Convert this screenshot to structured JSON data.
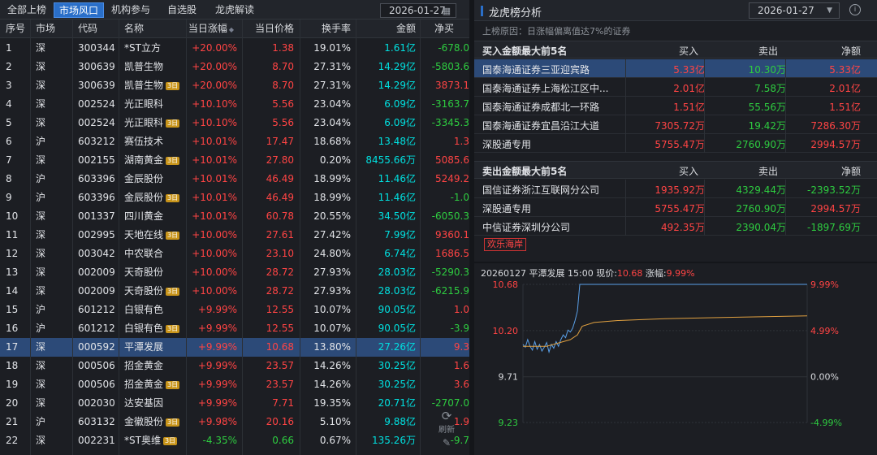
{
  "tabs": [
    "全部上榜",
    "市场风口",
    "机构参与",
    "自选股",
    "龙虎解读"
  ],
  "active_tab": 1,
  "date_left": "2026-01-27",
  "columns": [
    "序号",
    "市场",
    "代码",
    "名称",
    "当日涨幅",
    "当日价格",
    "换手率",
    "金额",
    "净买"
  ],
  "sort_icon": "◆",
  "rows": [
    {
      "no": "1",
      "mkt": "深",
      "code": "300344",
      "name": "*ST立方",
      "badge": "",
      "chg": "+20.00%",
      "price": "1.38",
      "turn": "19.01%",
      "amt": "1.61亿",
      "net": "-678.0",
      "netc": "green"
    },
    {
      "no": "2",
      "mkt": "深",
      "code": "300639",
      "name": "凯普生物",
      "badge": "",
      "chg": "+20.00%",
      "price": "8.70",
      "turn": "27.31%",
      "amt": "14.29亿",
      "net": "-5803.6",
      "netc": "green"
    },
    {
      "no": "3",
      "mkt": "深",
      "code": "300639",
      "name": "凯普生物",
      "badge": "3日",
      "chg": "+20.00%",
      "price": "8.70",
      "turn": "27.31%",
      "amt": "14.29亿",
      "net": "3873.1",
      "netc": "red"
    },
    {
      "no": "4",
      "mkt": "深",
      "code": "002524",
      "name": "光正眼科",
      "badge": "",
      "chg": "+10.10%",
      "price": "5.56",
      "turn": "23.04%",
      "amt": "6.09亿",
      "net": "-3163.7",
      "netc": "green"
    },
    {
      "no": "5",
      "mkt": "深",
      "code": "002524",
      "name": "光正眼科",
      "badge": "3日",
      "chg": "+10.10%",
      "price": "5.56",
      "turn": "23.04%",
      "amt": "6.09亿",
      "net": "-3345.3",
      "netc": "green"
    },
    {
      "no": "6",
      "mkt": "沪",
      "code": "603212",
      "name": "赛伍技术",
      "badge": "",
      "chg": "+10.01%",
      "price": "17.47",
      "turn": "18.68%",
      "amt": "13.48亿",
      "net": "1.3",
      "netc": "red"
    },
    {
      "no": "7",
      "mkt": "深",
      "code": "002155",
      "name": "湖南黄金",
      "badge": "3日",
      "chg": "+10.01%",
      "price": "27.80",
      "turn": "0.20%",
      "amt": "8455.66万",
      "net": "5085.6",
      "netc": "red"
    },
    {
      "no": "8",
      "mkt": "沪",
      "code": "603396",
      "name": "金辰股份",
      "badge": "",
      "chg": "+10.01%",
      "price": "46.49",
      "turn": "18.99%",
      "amt": "11.46亿",
      "net": "5249.2",
      "netc": "red"
    },
    {
      "no": "9",
      "mkt": "沪",
      "code": "603396",
      "name": "金辰股份",
      "badge": "3日",
      "chg": "+10.01%",
      "price": "46.49",
      "turn": "18.99%",
      "amt": "11.46亿",
      "net": "-1.0",
      "netc": "green"
    },
    {
      "no": "10",
      "mkt": "深",
      "code": "001337",
      "name": "四川黄金",
      "badge": "",
      "chg": "+10.01%",
      "price": "60.78",
      "turn": "20.55%",
      "amt": "34.50亿",
      "net": "-6050.3",
      "netc": "green"
    },
    {
      "no": "11",
      "mkt": "深",
      "code": "002995",
      "name": "天地在线",
      "badge": "3日",
      "chg": "+10.00%",
      "price": "27.61",
      "turn": "27.42%",
      "amt": "7.99亿",
      "net": "9360.1",
      "netc": "red"
    },
    {
      "no": "12",
      "mkt": "深",
      "code": "003042",
      "name": "中农联合",
      "badge": "",
      "chg": "+10.00%",
      "price": "23.10",
      "turn": "24.80%",
      "amt": "6.74亿",
      "net": "1686.5",
      "netc": "red"
    },
    {
      "no": "13",
      "mkt": "深",
      "code": "002009",
      "name": "天奇股份",
      "badge": "",
      "chg": "+10.00%",
      "price": "28.72",
      "turn": "27.93%",
      "amt": "28.03亿",
      "net": "-5290.3",
      "netc": "green"
    },
    {
      "no": "14",
      "mkt": "深",
      "code": "002009",
      "name": "天奇股份",
      "badge": "3日",
      "chg": "+10.00%",
      "price": "28.72",
      "turn": "27.93%",
      "amt": "28.03亿",
      "net": "-6215.9",
      "netc": "green"
    },
    {
      "no": "15",
      "mkt": "沪",
      "code": "601212",
      "name": "白银有色",
      "badge": "",
      "chg": "+9.99%",
      "price": "12.55",
      "turn": "10.07%",
      "amt": "90.05亿",
      "net": "1.0",
      "netc": "red"
    },
    {
      "no": "16",
      "mkt": "沪",
      "code": "601212",
      "name": "白银有色",
      "badge": "3日",
      "chg": "+9.99%",
      "price": "12.55",
      "turn": "10.07%",
      "amt": "90.05亿",
      "net": "-3.9",
      "netc": "green"
    },
    {
      "no": "17",
      "mkt": "深",
      "code": "000592",
      "name": "平潭发展",
      "badge": "",
      "chg": "+9.99%",
      "price": "10.68",
      "turn": "13.80%",
      "amt": "27.26亿",
      "net": "9.3",
      "netc": "red",
      "selected": true
    },
    {
      "no": "18",
      "mkt": "深",
      "code": "000506",
      "name": "招金黄金",
      "badge": "",
      "chg": "+9.99%",
      "price": "23.57",
      "turn": "14.26%",
      "amt": "30.25亿",
      "net": "1.6",
      "netc": "red"
    },
    {
      "no": "19",
      "mkt": "深",
      "code": "000506",
      "name": "招金黄金",
      "badge": "3日",
      "chg": "+9.99%",
      "price": "23.57",
      "turn": "14.26%",
      "amt": "30.25亿",
      "net": "3.6",
      "netc": "red"
    },
    {
      "no": "20",
      "mkt": "深",
      "code": "002030",
      "name": "达安基因",
      "badge": "",
      "chg": "+9.99%",
      "price": "7.71",
      "turn": "19.35%",
      "amt": "20.71亿",
      "net": "-2707.0",
      "netc": "green"
    },
    {
      "no": "21",
      "mkt": "沪",
      "code": "603132",
      "name": "金徽股份",
      "badge": "3日",
      "chg": "+9.98%",
      "price": "20.16",
      "turn": "5.10%",
      "amt": "9.88亿",
      "net": "1.9",
      "netc": "red"
    },
    {
      "no": "22",
      "mkt": "深",
      "code": "002231",
      "name": "*ST奥维",
      "badge": "3日",
      "chg": "-4.35%",
      "price": "0.66",
      "turn": "0.67%",
      "amt": "135.26万",
      "net": "-9.7",
      "netc": "green",
      "chgc": "green"
    }
  ],
  "refresh_label": "刷新",
  "right": {
    "title": "龙虎榜分析",
    "date": "2026-01-27",
    "info_icon": "i",
    "reason": "上榜原因：日涨幅偏离值达7%的证券",
    "buy_section": {
      "title": "买入金额最大前5名",
      "cols": [
        "买入",
        "卖出",
        "净额"
      ],
      "rows": [
        {
          "name": "国泰海通证券三亚迎宾路",
          "buy": "5.33亿",
          "sell": "10.30万",
          "net": "5.33亿",
          "netc": "red",
          "selected": true
        },
        {
          "name": "国泰海通证券上海松江区中...",
          "buy": "2.01亿",
          "sell": "7.58万",
          "net": "2.01亿",
          "netc": "red"
        },
        {
          "name": "国泰海通证券成都北一环路",
          "buy": "1.51亿",
          "sell": "55.56万",
          "net": "1.51亿",
          "netc": "red"
        },
        {
          "name": "国泰海通证券宜昌沿江大道",
          "buy": "7305.72万",
          "sell": "19.42万",
          "net": "7286.30万",
          "netc": "red"
        },
        {
          "name": "深股通专用",
          "buy": "5755.47万",
          "sell": "2760.90万",
          "net": "2994.57万",
          "netc": "red"
        }
      ]
    },
    "sell_section": {
      "title": "卖出金额最大前5名",
      "cols": [
        "买入",
        "卖出",
        "净额"
      ],
      "rows": [
        {
          "name": "国信证券浙江互联网分公司",
          "buy": "1935.92万",
          "sell": "4329.44万",
          "net": "-2393.52万",
          "netc": "green"
        },
        {
          "name": "深股通专用",
          "buy": "5755.47万",
          "sell": "2760.90万",
          "net": "2994.57万",
          "netc": "red"
        },
        {
          "name": "中信证券深圳分公司",
          "buy": "492.35万",
          "sell": "2390.04万",
          "net": "-1897.69万",
          "netc": "green"
        }
      ]
    },
    "tag": "欢乐海岸",
    "chart_title": {
      "date": "20260127",
      "name": "平潭发展",
      "time": "15:00",
      "price_label": "现价:",
      "price": "10.68",
      "chg_label": "涨幅:",
      "chg": "9.99%"
    }
  },
  "chart_data": {
    "type": "line",
    "title": "",
    "xlabel": "",
    "ylabel": "",
    "y_left_ticks": [
      "10.68",
      "10.20",
      "9.71",
      "9.23"
    ],
    "y_right_ticks": [
      "9.99%",
      "4.99%",
      "0.00%",
      "-4.99%"
    ],
    "ylim": [
      9.23,
      10.68
    ],
    "base": 9.71,
    "x_minutes": 240,
    "series": [
      {
        "kind": "price",
        "color": "#5aa0e8",
        "x": [
          0,
          2,
          4,
          6,
          8,
          10,
          12,
          14,
          16,
          18,
          20,
          22,
          24,
          26,
          28,
          30,
          32,
          34,
          36,
          38,
          40,
          42,
          44,
          46,
          48,
          50,
          52,
          54,
          56,
          58,
          60,
          240
        ],
        "values": [
          10.05,
          10.02,
          10.1,
          10.03,
          9.99,
          10.08,
          10.0,
          10.05,
          9.98,
          10.02,
          10.07,
          9.97,
          10.05,
          10.01,
          10.08,
          10.03,
          10.1,
          10.15,
          10.12,
          10.2,
          10.18,
          10.22,
          10.3,
          10.4,
          10.68,
          10.68,
          10.68,
          10.68,
          10.68,
          10.68,
          10.68,
          10.68
        ]
      },
      {
        "kind": "average",
        "color": "#e0a040",
        "x": [
          0,
          20,
          40,
          46,
          50,
          60,
          80,
          100,
          120,
          160,
          200,
          240
        ],
        "values": [
          10.03,
          10.03,
          10.1,
          10.15,
          10.24,
          10.28,
          10.3,
          10.31,
          10.32,
          10.33,
          10.34,
          10.35
        ]
      }
    ],
    "colors": {
      "up": "#ff4444",
      "down": "#2ecc40",
      "neutral": "#d8dade",
      "grid": "#2e3238"
    }
  }
}
